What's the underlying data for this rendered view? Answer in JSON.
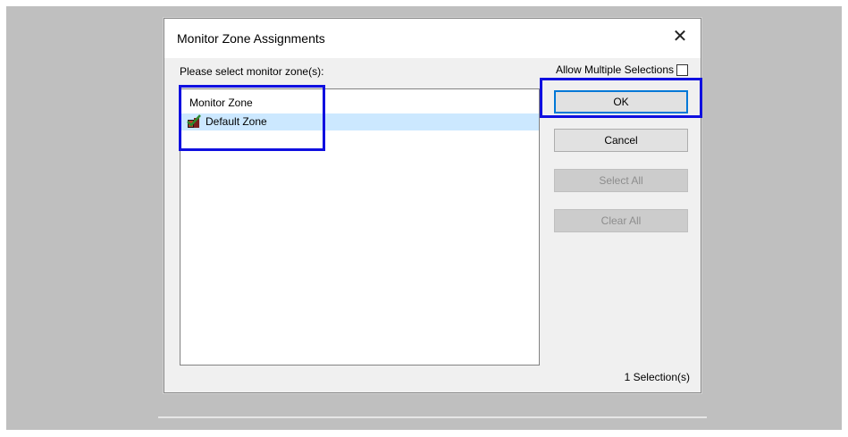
{
  "dialog": {
    "title": "Monitor Zone Assignments",
    "close_glyph": "✕",
    "prompt": "Please select monitor zone(s):",
    "allow_multiple_label": "Allow Multiple Selections",
    "allow_multiple_checked": false
  },
  "list": {
    "header": "Monitor Zone",
    "items": [
      {
        "label": "Default Zone",
        "icon": "zone-check-icon",
        "selected": true
      }
    ]
  },
  "buttons": {
    "ok": "OK",
    "cancel": "Cancel",
    "select_all": "Select All",
    "clear_all": "Clear All"
  },
  "status": "1 Selection(s)",
  "colors": {
    "highlight": "#1010e0",
    "selection": "#cce8ff",
    "backdrop": "#bfbfbf"
  }
}
